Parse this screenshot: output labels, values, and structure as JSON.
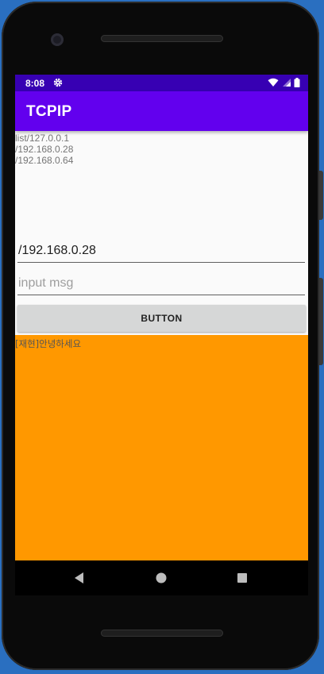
{
  "status_bar": {
    "time": "8:08",
    "icons": [
      "settings-gear-icon",
      "wifi-icon",
      "cell-signal-icon",
      "battery-icon"
    ]
  },
  "app_bar": {
    "title": "TCPIP"
  },
  "ip_list": {
    "lines": [
      "list/127.0.0.1",
      "/192.168.0.28",
      "/192.168.0.64"
    ]
  },
  "target_ip": {
    "value": "/192.168.0.28"
  },
  "message_input": {
    "value": "",
    "placeholder": "input msg"
  },
  "send_button": {
    "label": "BUTTON"
  },
  "chat_log": {
    "messages": [
      "[재현]안녕하세요"
    ]
  },
  "nav_bar": {
    "icons": [
      "back-icon",
      "home-icon",
      "recents-icon"
    ]
  },
  "colors": {
    "status_bar": "#3700b3",
    "app_bar": "#6200ee",
    "chat_background": "#ff9800",
    "button": "#d6d7d7"
  }
}
